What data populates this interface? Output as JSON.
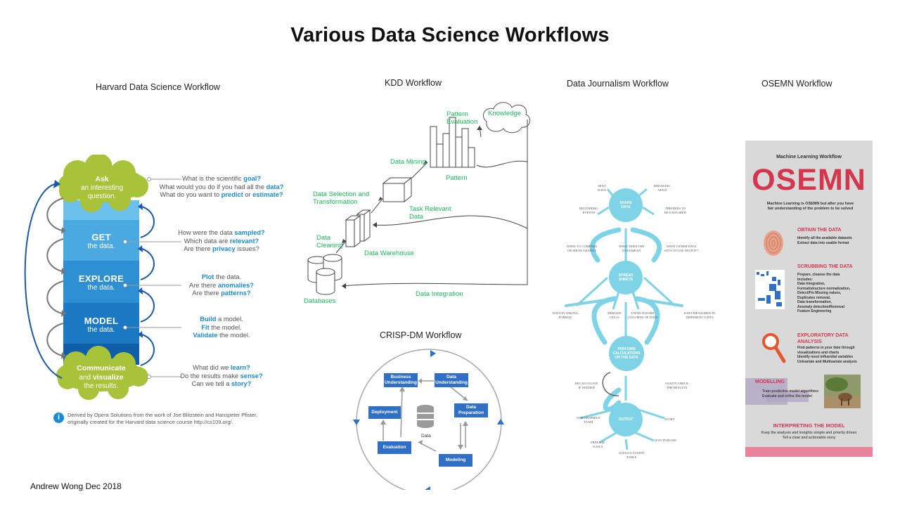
{
  "title": "Various Data Science Workflows",
  "footer": "Andrew Wong Dec 2018",
  "harvard": {
    "title": "Harvard Data Science  Workflow",
    "ask": {
      "head": "Ask",
      "l2": "an interesting",
      "l3": "question."
    },
    "get": {
      "head": "GET",
      "sub": "the data."
    },
    "explore": {
      "head": "EXPLORE",
      "sub": "the data."
    },
    "model": {
      "head": "MODEL",
      "sub": "the data."
    },
    "communicate": {
      "head": "Communicate",
      "l2a": "and ",
      "l2b": "visualize",
      "l3": "the results."
    },
    "q1": {
      "a": "What is the scientific ",
      "b": "goal?",
      "c": "What would you do if you had all the ",
      "d": "data?",
      "e": "What do you want to ",
      "f": "predict",
      "g": " or ",
      "h": "estimate?"
    },
    "q2": {
      "a": "How were the data ",
      "b": "sampled?",
      "c": "Which data are ",
      "d": "relevant?",
      "e": "Are there ",
      "f": "privacy",
      "g": " issues?"
    },
    "q3": {
      "a": "Plot",
      "b": " the data.",
      "c": "Are there ",
      "d": "anomalies?",
      "e": "Are there ",
      "f": "patterns?"
    },
    "q4": {
      "a": "Build",
      "b": " a model.",
      "c": "Fit",
      "d": " the model.",
      "e": "Validate",
      "f": " the model."
    },
    "q5": {
      "a": "What did we ",
      "b": "learn?",
      "c": "Do the results make ",
      "d": "sense?",
      "e": "Can we tell a ",
      "f": "story?"
    },
    "note1": "Derived by Opera Solutions from the work of Joe Blitzstein and Hanspeter Pfister,",
    "note2": "originally created for the Harvard data science course http://cs109.org/.",
    "info_icon": "i"
  },
  "kdd": {
    "title": "KDD Workflow",
    "knowledge": "Knowledge",
    "pattern_eval": [
      "Pattern",
      "Evaluation"
    ],
    "data_mining": "Data Mining",
    "pattern": "Pattern",
    "selection": [
      "Data Selection and",
      "Transformation"
    ],
    "task_relevant": [
      "Task Relevant",
      "Data"
    ],
    "cleaning": [
      "Data",
      "Cleaning"
    ],
    "warehouse": "Data Warehouse",
    "databases": "Databases",
    "integration": "Data Integration"
  },
  "crisp": {
    "title": "CRISP-DM Workflow",
    "business": [
      "Business",
      "Understanding"
    ],
    "data_und": [
      "Data",
      "Understanding"
    ],
    "data_prep": [
      "Data",
      "Preparation"
    ],
    "modeling": "Modeling",
    "evaluation": "Evaluation",
    "deployment": "Deployment",
    "data": "Data"
  },
  "journalism": {
    "title": "Data Journalism Workflow",
    "node_share": [
      "SHARE",
      "DATA"
    ],
    "node_spread": [
      "SPREAD",
      "SHEETS"
    ],
    "node_calc": [
      "PERFORM",
      "CALCULATIONS",
      "ON THE DATA"
    ],
    "node_output": "OUTPUT",
    "sent_data": [
      "SENT",
      "DATA"
    ],
    "breaking_news": [
      "BREAKING",
      "NEWS"
    ],
    "recurring": [
      "RECURRING",
      "EVENTS"
    ],
    "theories": [
      "THEORIES TO",
      "BE EXPLORED"
    ],
    "compare": [
      "WHAT TO COMPARE",
      "OR SHOW CHANGE"
    ],
    "mean": [
      "WHAT DOES THE",
      "DATA MEAN"
    ],
    "other_data": [
      "WHAT OTHER DATA",
      "SETS TO USE WITH IT?"
    ],
    "wrong_format": [
      "DATA IN WRONG",
      "FORMAT"
    ],
    "merged": [
      "MERGED",
      "CELLS"
    ],
    "unnecessary": [
      "UNNECESSARY",
      "COLUMNS OF DATA"
    ],
    "diff_units": [
      "DATA MEASURED IN",
      "DIFFERENT UNITS"
    ],
    "recalc": [
      "RECALCULATE",
      "IF NEEDED"
    ],
    "sanity": [
      "SANITY CHECK",
      "THE RESULTS"
    ],
    "graphics": [
      "OUR GRAPHICS",
      "TEAM"
    ],
    "story": "STORY",
    "free_viz": [
      "FREE VIZ",
      "TOOLS"
    ],
    "just_publish": "JUST PUBLISH",
    "fusion": [
      "GOOGLE FUSION",
      "TABLE"
    ]
  },
  "osemn": {
    "title": "OSEMN Workflow",
    "header": "Machine Learning Workflow",
    "big": "OSEMN",
    "intro": [
      "Machine Learning is OSEMN but after you have",
      "fair understanding of the problem to be solved"
    ],
    "obtain": "OBTAIN THE DATA",
    "obtain_d": [
      "Identify all the available datasets",
      "Extract data into usable format"
    ],
    "scrub": "SCRUBBING THE DATA",
    "scrub_d": [
      "Prepare, cleanse the data",
      "Includes:",
      "Data Integration,",
      "Format/structure normalization,",
      "Detect/Fix Missing values,",
      "Duplicates removal,",
      "Data transformation,",
      "Anomaly detection/Removal",
      "Feature Engineering"
    ],
    "explore": [
      "EXPLORATORY DATA",
      "ANALYSIS"
    ],
    "explore_d": [
      "Find patterns in your date through",
      "visualizations and charts",
      "Identify most influential variables",
      "Univariate and Multivariate analysis"
    ],
    "modelling": "MODELLING",
    "modelling_d": [
      "Train predictive model algorithms",
      "Evaluate and refine the model"
    ],
    "interpret": "INTERPRETING THE MODEL",
    "interpret_d": [
      "Keep the analysis and insights simple and priority driven",
      "Tell a clear and actionable story"
    ],
    "accent": "#d4364d",
    "footer_bar": "#e9829b"
  },
  "colors": {
    "cloud": "#a8c23a",
    "band1": "#6cc0ec",
    "band2": "#4aa9e0",
    "band3": "#2e8fd3",
    "band4": "#1b78c2",
    "band5": "#0f5ea8"
  }
}
